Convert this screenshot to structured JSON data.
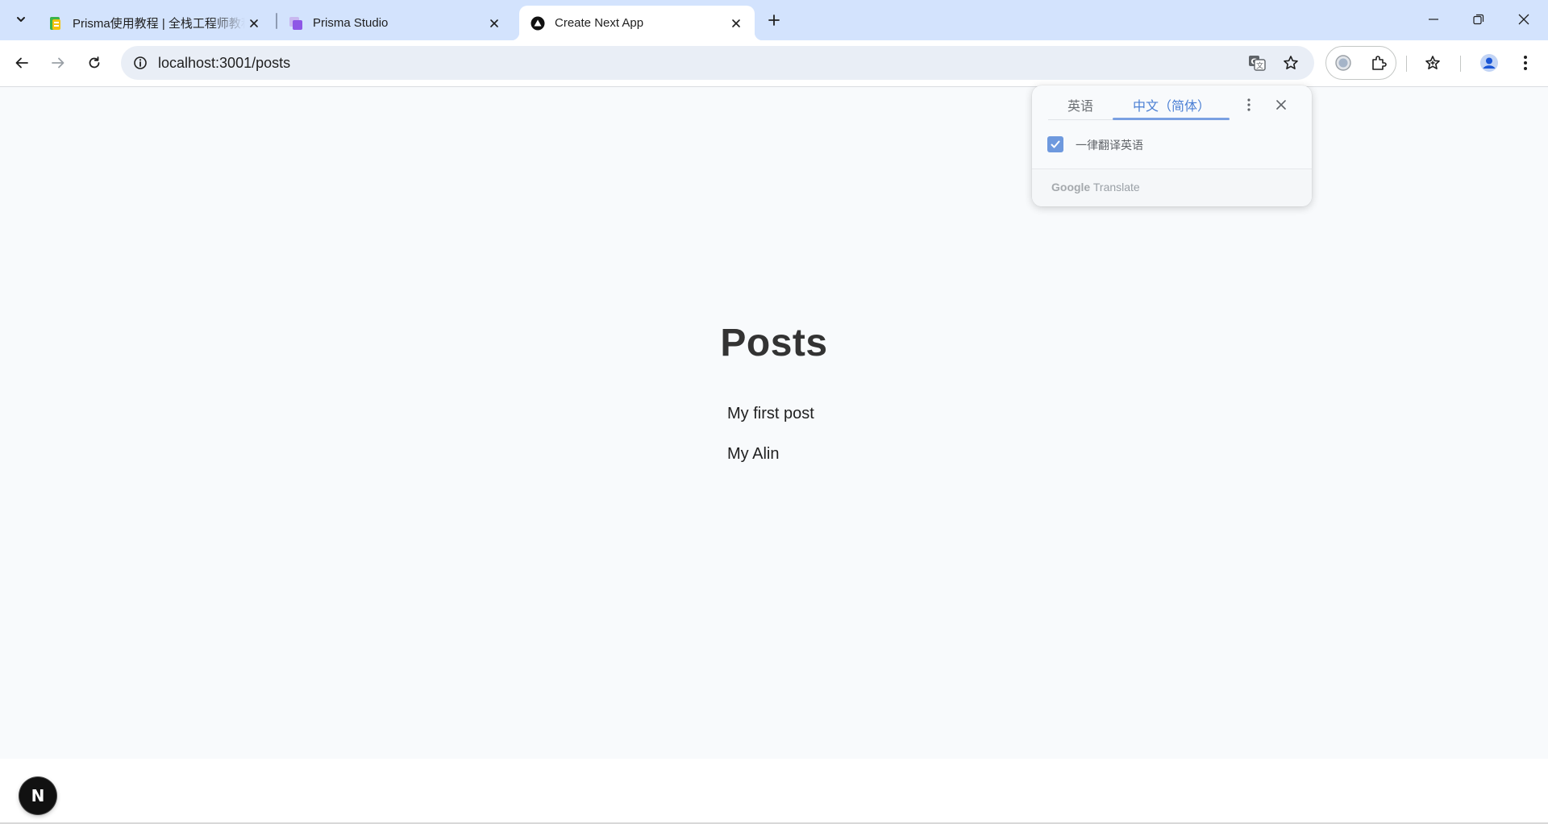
{
  "browser": {
    "tabs": [
      {
        "title": "Prisma使用教程 | 全栈工程师教程",
        "favicon": "green-docs-icon",
        "active": false
      },
      {
        "title": "Prisma Studio",
        "favicon": "purple-prisma-icon",
        "active": false
      },
      {
        "title": "Create Next App",
        "favicon": "nextjs-triangle-icon",
        "active": true
      }
    ],
    "address_bar": {
      "url": "localhost:3001/posts"
    },
    "colors": {
      "tabstrip": "#d3e3fd",
      "active_tab": "#ffffff",
      "omnibox": "#e9eef6"
    }
  },
  "page": {
    "title": "Posts",
    "posts": [
      "My first post",
      "My Alin"
    ],
    "dev_badge_letter": "N",
    "background": "#f8fafc"
  },
  "translate_popup": {
    "source_language": "英语",
    "target_language": "中文（简体）",
    "always_translate_label": "一律翻译英语",
    "always_translate_checked": true,
    "brand_google": "Google",
    "brand_translate": "Translate",
    "accent": "#7aa0e2"
  }
}
